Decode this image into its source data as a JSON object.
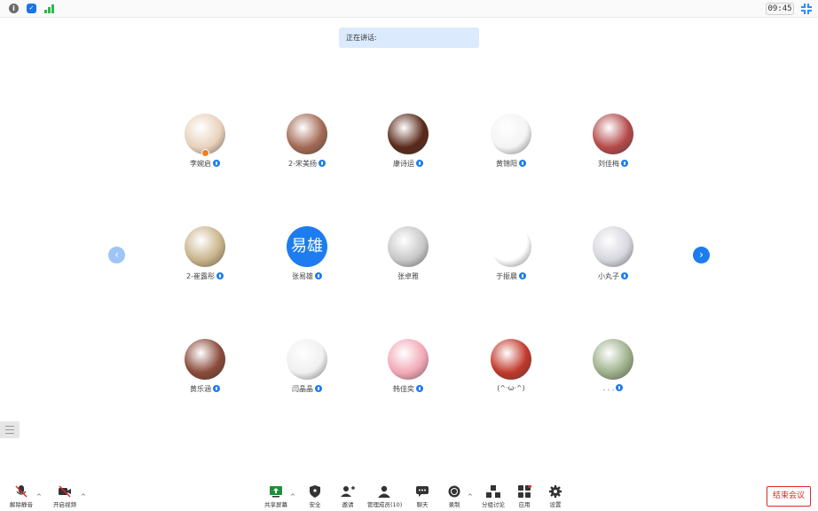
{
  "statusbar": {
    "info_icon": "info-icon",
    "shield_icon": "shield-icon",
    "signal_icon": "signal-icon",
    "clock": "09:45",
    "fullscreen_icon": "fullscreen-icon"
  },
  "speaking": {
    "label": "正在讲话:"
  },
  "grid": {
    "prev_icon": "chevron-left-icon",
    "next_icon": "chevron-right-icon",
    "participants": [
      {
        "name": "李婉启",
        "avatar_text": "",
        "avatar_color": "#e8d2bb",
        "host": true
      },
      {
        "name": "2-宋美扬",
        "avatar_text": "",
        "avatar_color": "#a36a55",
        "host": false
      },
      {
        "name": "康诗运",
        "avatar_text": "",
        "avatar_color": "#5a2a1a",
        "host": false
      },
      {
        "name": "黄锦阳",
        "avatar_text": "",
        "avatar_color": "#f4f4f4",
        "host": false
      },
      {
        "name": "刘佳梅",
        "avatar_text": "",
        "avatar_color": "#b54a4a",
        "host": false
      },
      {
        "name": "2-崔露彤",
        "avatar_text": "",
        "avatar_color": "#c9b48a",
        "host": false
      },
      {
        "name": "张易雄",
        "avatar_text": "易雄",
        "avatar_color": "#1c7cf0",
        "host": false
      },
      {
        "name": "张卓雅",
        "avatar_text": "",
        "avatar_color": "#c8c8c8",
        "host": false
      },
      {
        "name": "于振晨",
        "avatar_text": "",
        "avatar_color": "#ffffff",
        "host": false
      },
      {
        "name": "小丸子",
        "avatar_text": "",
        "avatar_color": "#d6d6de",
        "host": false
      },
      {
        "name": "黄乐涵",
        "avatar_text": "",
        "avatar_color": "#8a4a3a",
        "host": false
      },
      {
        "name": "闫晶晶",
        "avatar_text": "",
        "avatar_color": "#f0f0f0",
        "host": false
      },
      {
        "name": "韩佳奕",
        "avatar_text": "",
        "avatar_color": "#f2a8b6",
        "host": false
      },
      {
        "name": "(^·ω·^)",
        "avatar_text": "",
        "avatar_color": "#c0392b",
        "host": false
      },
      {
        "name": ". . .",
        "avatar_text": "",
        "avatar_color": "#9db08a",
        "host": false
      }
    ]
  },
  "toolbar": {
    "mute": "解除静音",
    "video": "开启视频",
    "share": "共享屏幕",
    "security": "安全",
    "invite": "邀请",
    "participants": "管理成员(10)",
    "chat": "聊天",
    "record": "录制",
    "breakout": "分组讨论",
    "apps": "应用",
    "settings": "设置",
    "end": "结束会议"
  }
}
